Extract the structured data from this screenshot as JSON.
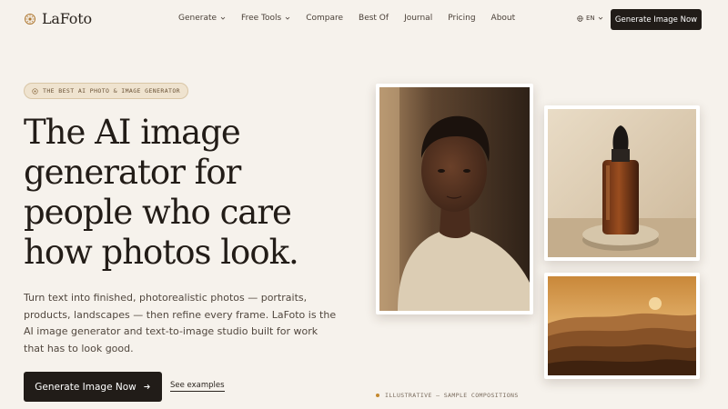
{
  "header": {
    "brand": "LaFoto",
    "nav": [
      {
        "label": "Generate",
        "has_dropdown": true
      },
      {
        "label": "Free Tools",
        "has_dropdown": true
      },
      {
        "label": "Compare",
        "has_dropdown": false
      },
      {
        "label": "Best Of",
        "has_dropdown": false
      },
      {
        "label": "Journal",
        "has_dropdown": false
      },
      {
        "label": "Pricing",
        "has_dropdown": false
      },
      {
        "label": "About",
        "has_dropdown": false
      }
    ],
    "language": "EN",
    "cta": "Generate Image Now"
  },
  "hero": {
    "badge": "THE BEST AI PHOTO & IMAGE GENERATOR",
    "headline_lines": [
      "The AI image",
      "generator for",
      "people who care",
      "how photos look."
    ],
    "lead": "Turn text into finished, photorealistic photos — portraits, products, landscapes — then refine every frame. LaFoto is the AI image generator and text-to-image studio built for work that has to look good.",
    "primary_cta": "Generate Image Now",
    "secondary_cta": "See examples",
    "caption": "ILLUSTRATIVE — SAMPLE COMPOSITIONS"
  },
  "icons": {
    "brand": "sun-mark-icon",
    "dropdown": "chevron-down-icon",
    "language": "globe-icon",
    "badge": "sparkle-icon",
    "cta_arrow": "arrow-right-icon"
  },
  "colors": {
    "background": "#f6f2ec",
    "primary_button": "#211c18",
    "badge_bg": "#efe3cf",
    "accent_dot": "#c4892f"
  }
}
